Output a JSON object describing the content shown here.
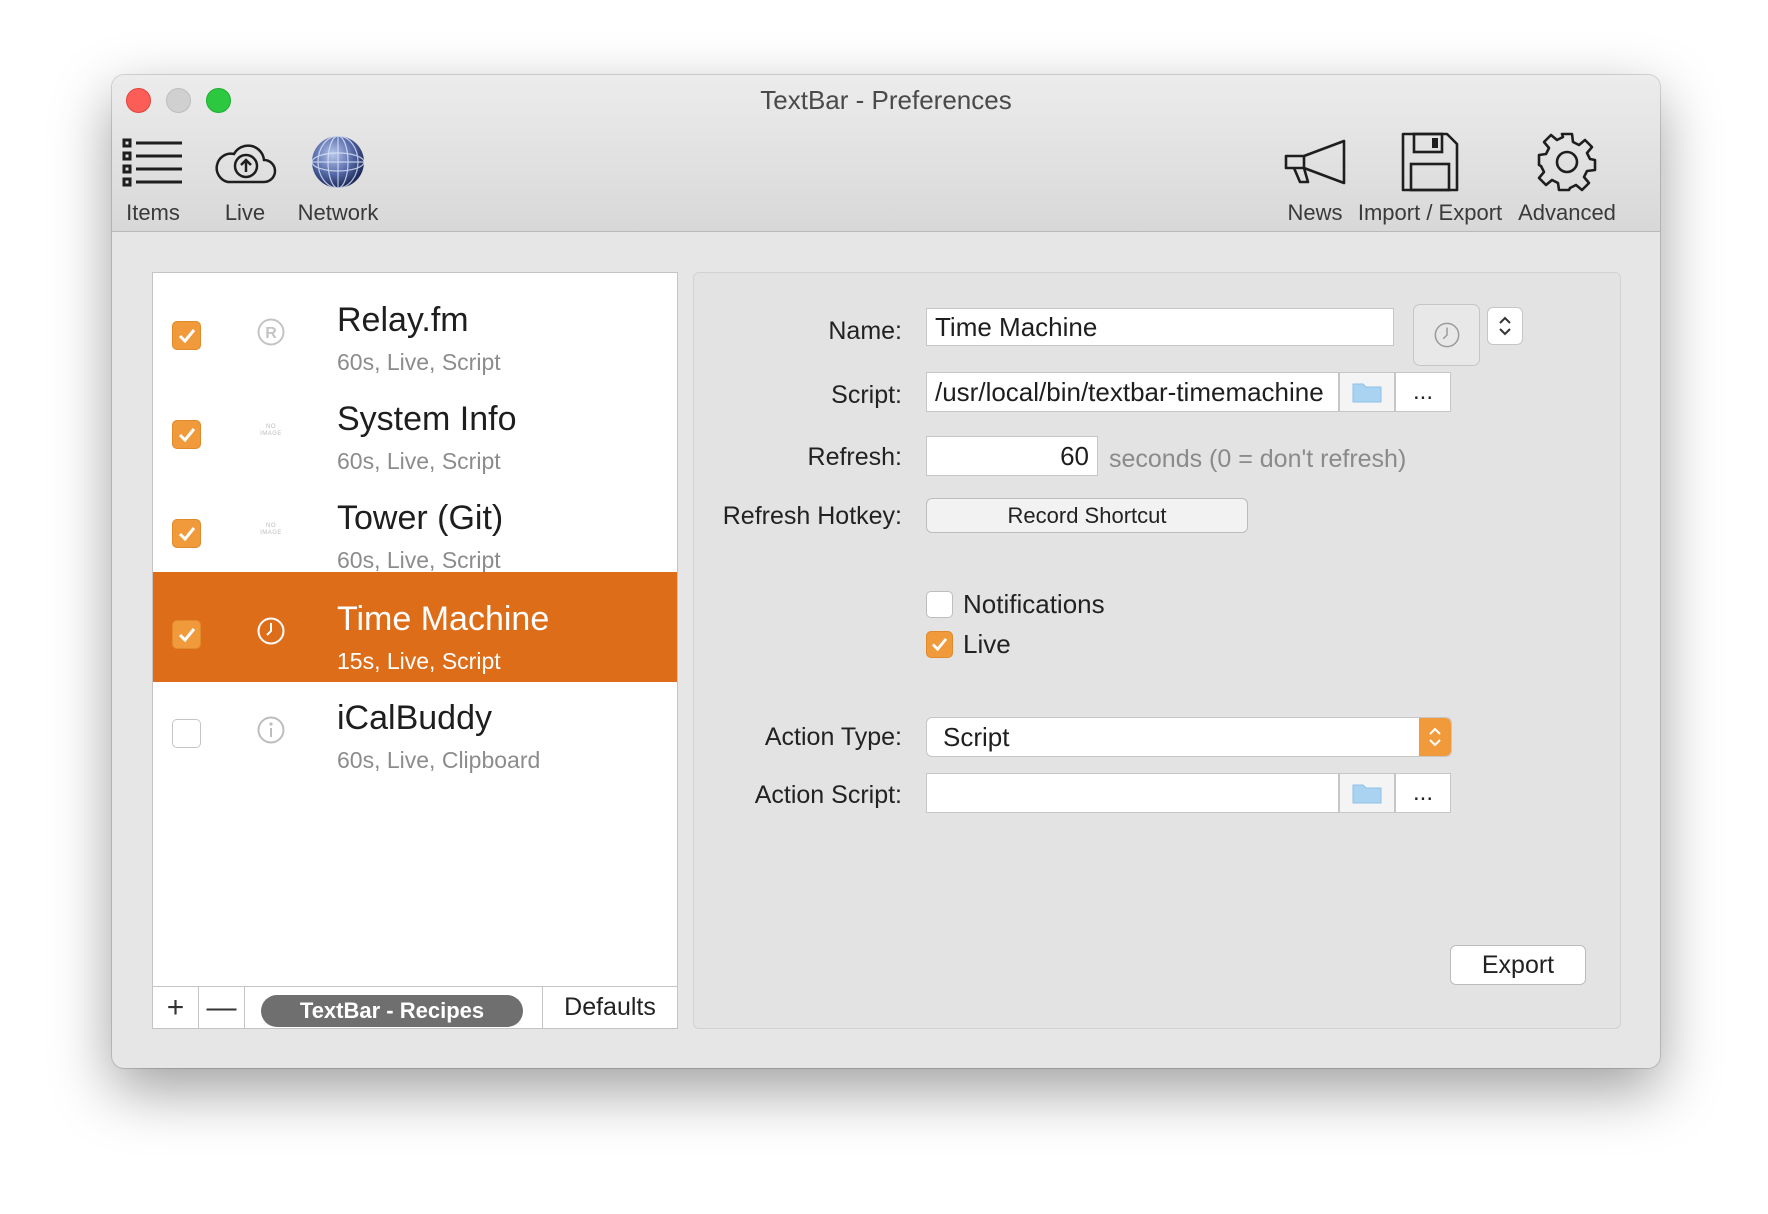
{
  "window": {
    "title": "TextBar - Preferences"
  },
  "toolbar": {
    "left": [
      {
        "label": "Items",
        "icon": "list-icon"
      },
      {
        "label": "Live",
        "icon": "cloud-upload-icon"
      },
      {
        "label": "Network",
        "icon": "globe-icon"
      }
    ],
    "right": [
      {
        "label": "News",
        "icon": "megaphone-icon"
      },
      {
        "label": "Import / Export",
        "icon": "floppy-disk-icon"
      },
      {
        "label": "Advanced",
        "icon": "gear-icon"
      }
    ]
  },
  "items": [
    {
      "title": "Relay.fm",
      "subtitle": "60s, Live, Script",
      "enabled": true,
      "icon": "registered-icon"
    },
    {
      "title": "System Info",
      "subtitle": "60s, Live, Script",
      "enabled": true,
      "icon": "no-image-icon",
      "icon_text": "NO IMAGE"
    },
    {
      "title": "Tower (Git)",
      "subtitle": "60s, Live, Script",
      "enabled": true,
      "icon": "no-image-icon",
      "icon_text": "NO IMAGE"
    },
    {
      "title": "Time Machine",
      "subtitle": "15s, Live, Script",
      "enabled": true,
      "icon": "clock-icon",
      "selected": true
    },
    {
      "title": "iCalBuddy",
      "subtitle": "60s, Live, Clipboard",
      "enabled": false,
      "icon": "info-icon"
    }
  ],
  "list_footer": {
    "add": "+",
    "remove": "—",
    "recipes": "TextBar - Recipes",
    "defaults": "Defaults"
  },
  "detail": {
    "name_label": "Name:",
    "name_value": "Time Machine",
    "script_label": "Script:",
    "script_value": "/usr/local/bin/textbar-timemachine",
    "browse_more": "...",
    "refresh_label": "Refresh:",
    "refresh_value": "60",
    "refresh_hint": "seconds (0 = don't refresh)",
    "hotkey_label": "Refresh Hotkey:",
    "hotkey_button": "Record Shortcut",
    "notifications_label": "Notifications",
    "notifications_checked": false,
    "live_label": "Live",
    "live_checked": true,
    "action_type_label": "Action Type:",
    "action_type_value": "Script",
    "action_script_label": "Action Script:",
    "action_script_value": "",
    "action_more": "...",
    "export_button": "Export"
  },
  "colors": {
    "accent": "#de6d1a",
    "checkbox": "#f19a3b",
    "close": "#fd5d57",
    "maximize": "#2bc840"
  }
}
